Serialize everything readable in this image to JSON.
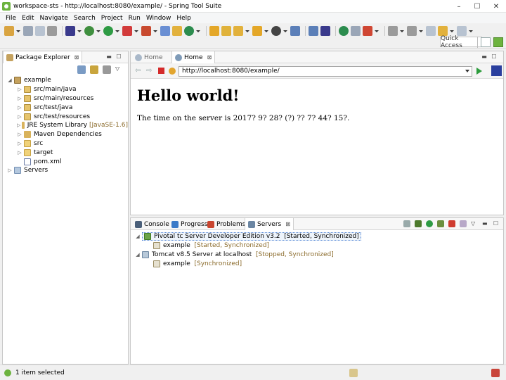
{
  "window": {
    "title": "workspace-sts - http://localhost:8080/example/ - Spring Tool Suite",
    "min": "–",
    "max": "☐",
    "close": "✕"
  },
  "menu": [
    "File",
    "Edit",
    "Navigate",
    "Search",
    "Project",
    "Run",
    "Window",
    "Help"
  ],
  "toolbar": {
    "quick_access": "Quick Access"
  },
  "package_explorer": {
    "tab_label": "Package Explorer",
    "tab_close": "⊠",
    "project": "example",
    "items": [
      {
        "label": "src/main/java",
        "decoration": ""
      },
      {
        "label": "src/main/resources",
        "decoration": ""
      },
      {
        "label": "src/test/java",
        "decoration": ""
      },
      {
        "label": "src/test/resources",
        "decoration": ""
      },
      {
        "label": "JRE System Library",
        "decoration": "[JavaSE-1.6]"
      },
      {
        "label": "Maven Dependencies",
        "decoration": ""
      },
      {
        "label": "src",
        "decoration": ""
      },
      {
        "label": "target",
        "decoration": ""
      },
      {
        "label": "pom.xml",
        "decoration": ""
      }
    ],
    "servers_node": "Servers"
  },
  "editor": {
    "tabs": [
      {
        "label": "Home",
        "active": false
      },
      {
        "label": "Home",
        "active": true
      }
    ],
    "tab_close": "⊠",
    "url": "http://localhost:8080/example/",
    "page_heading": "Hello world!",
    "page_text": "The time on the server is 2017? 9? 28? (?) ?? 7? 44? 15?."
  },
  "bottom_panel": {
    "tabs": [
      "Console",
      "Progress",
      "Problems",
      "Servers"
    ],
    "servers": [
      {
        "name": "Pivotal tc Server Developer Edition v3.2",
        "state": "[Started, Synchronized]",
        "module": "example",
        "module_state": "[Started, Synchronized]"
      },
      {
        "name": "Tomcat v8.5 Server at localhost",
        "state": "[Stopped, Synchronized]",
        "module": "example",
        "module_state": "[Synchronized]"
      }
    ]
  },
  "status": {
    "text": "1 item selected"
  },
  "colors": {
    "accent_green": "#6db33f",
    "decoration_brown": "#8a6a2a",
    "selection_border": "#5b8bd7"
  }
}
